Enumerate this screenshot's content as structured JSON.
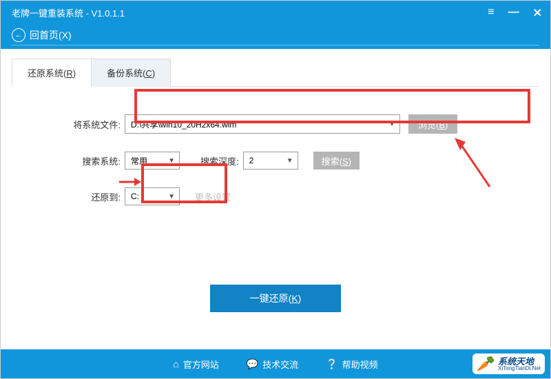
{
  "header": {
    "title": "老牌一键重装系统 - V1.0.1.1",
    "back_label": "回首页(X)"
  },
  "tabs": {
    "restore": "还原系统(R)",
    "backup": "备份系统(C)"
  },
  "form": {
    "file_label": "将系统文件:",
    "file_value": "D:\\共享\\win10_20H2x64.wim",
    "browse_label": "浏览(",
    "browse_key": "B",
    "browse_close": ")",
    "search_sys_label": "搜索系统:",
    "search_sys_value": "常用",
    "depth_label": "搜索深度:",
    "depth_value": "2",
    "search_label": "搜索(",
    "search_key": "S",
    "search_close": ")",
    "target_label": "还原到:",
    "target_value": "C:",
    "more_label": "更多设置"
  },
  "primary": {
    "label": "一键还原(",
    "key": "K",
    "close": ")"
  },
  "footer": {
    "site": "官方网站",
    "tech": "技术交流",
    "help": "帮助视频"
  },
  "logo": {
    "cn": "系统天地",
    "en": "XiTongTianDi.Net"
  }
}
